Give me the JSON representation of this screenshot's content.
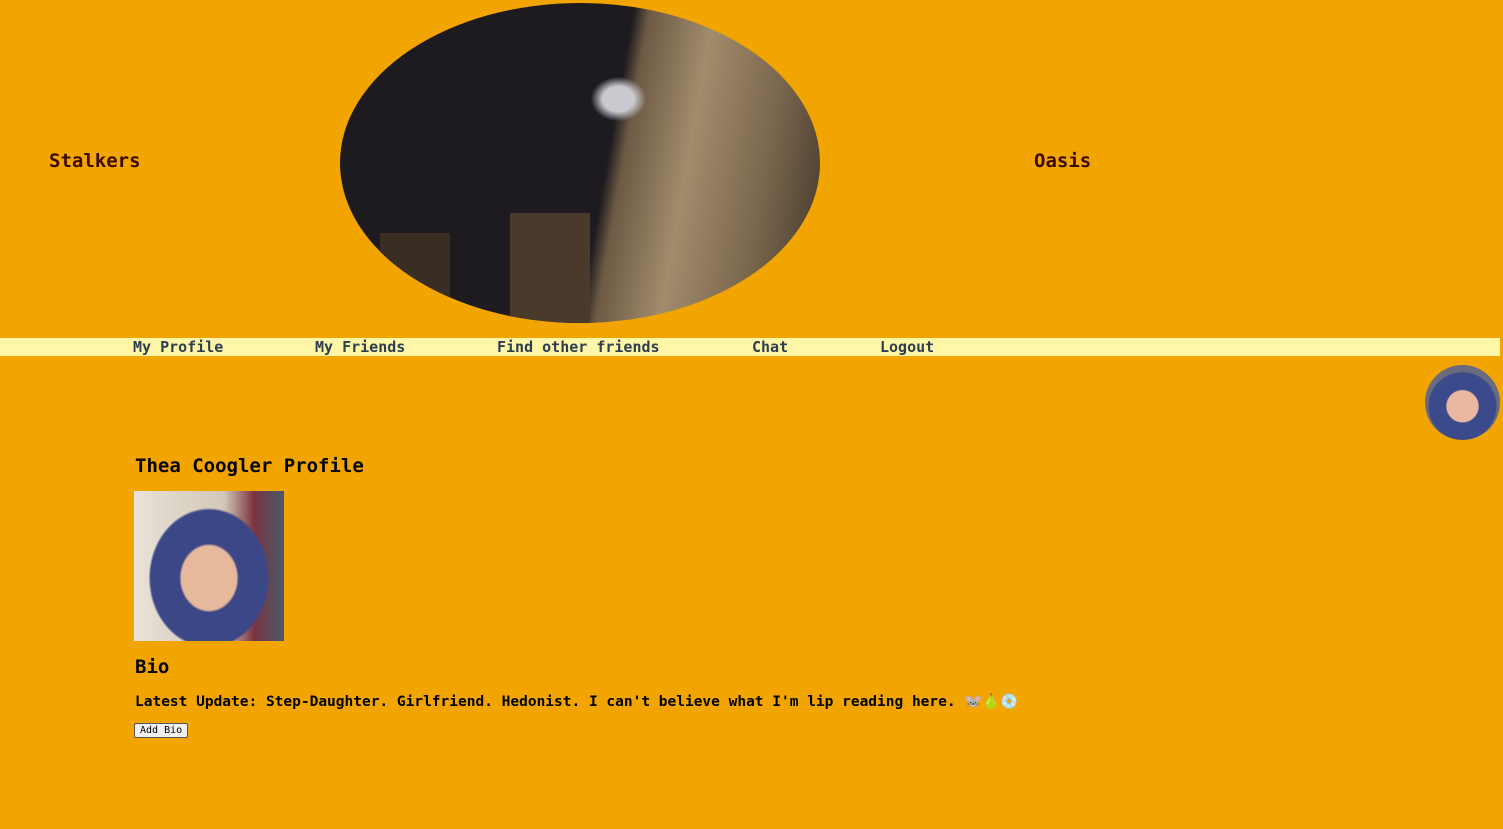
{
  "header": {
    "left_title": "Stalkers",
    "right_title": "Oasis",
    "hero_image": "cat peeking behind wooden post"
  },
  "nav": {
    "items": [
      {
        "label": "My Profile"
      },
      {
        "label": "My Friends"
      },
      {
        "label": "Find other friends"
      },
      {
        "label": "Chat"
      },
      {
        "label": "Logout"
      }
    ]
  },
  "profile": {
    "title": "Thea Coogler Profile",
    "bio_heading": "Bio",
    "latest_update": "Latest Update: Step-Daughter. Girlfriend. Hedonist. I can't believe what I'm lip reading here. 🐭🍐💿",
    "add_bio_label": "Add Bio"
  },
  "colors": {
    "background": "#f2a500",
    "nav_bg": "#fff6a8",
    "nav_text": "#2c3e50"
  }
}
